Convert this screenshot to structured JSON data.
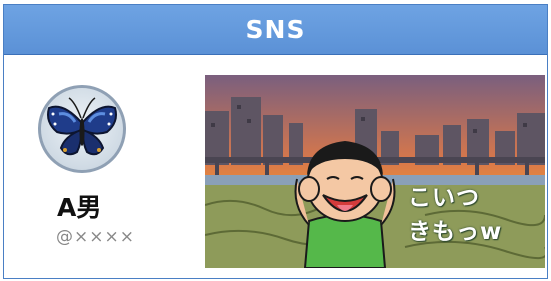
{
  "header": {
    "title": "SNS"
  },
  "post": {
    "user": {
      "name": "A男",
      "handle": "@××××"
    },
    "image": {
      "caption_lines": [
        "こいつ",
        "きもっw"
      ]
    }
  },
  "colors": {
    "header": "#5b91d6",
    "border": "#4a7fc4",
    "sky_top": "#7a5f7e",
    "sky_bottom": "#f6a52a",
    "handle_text": "#888888"
  }
}
